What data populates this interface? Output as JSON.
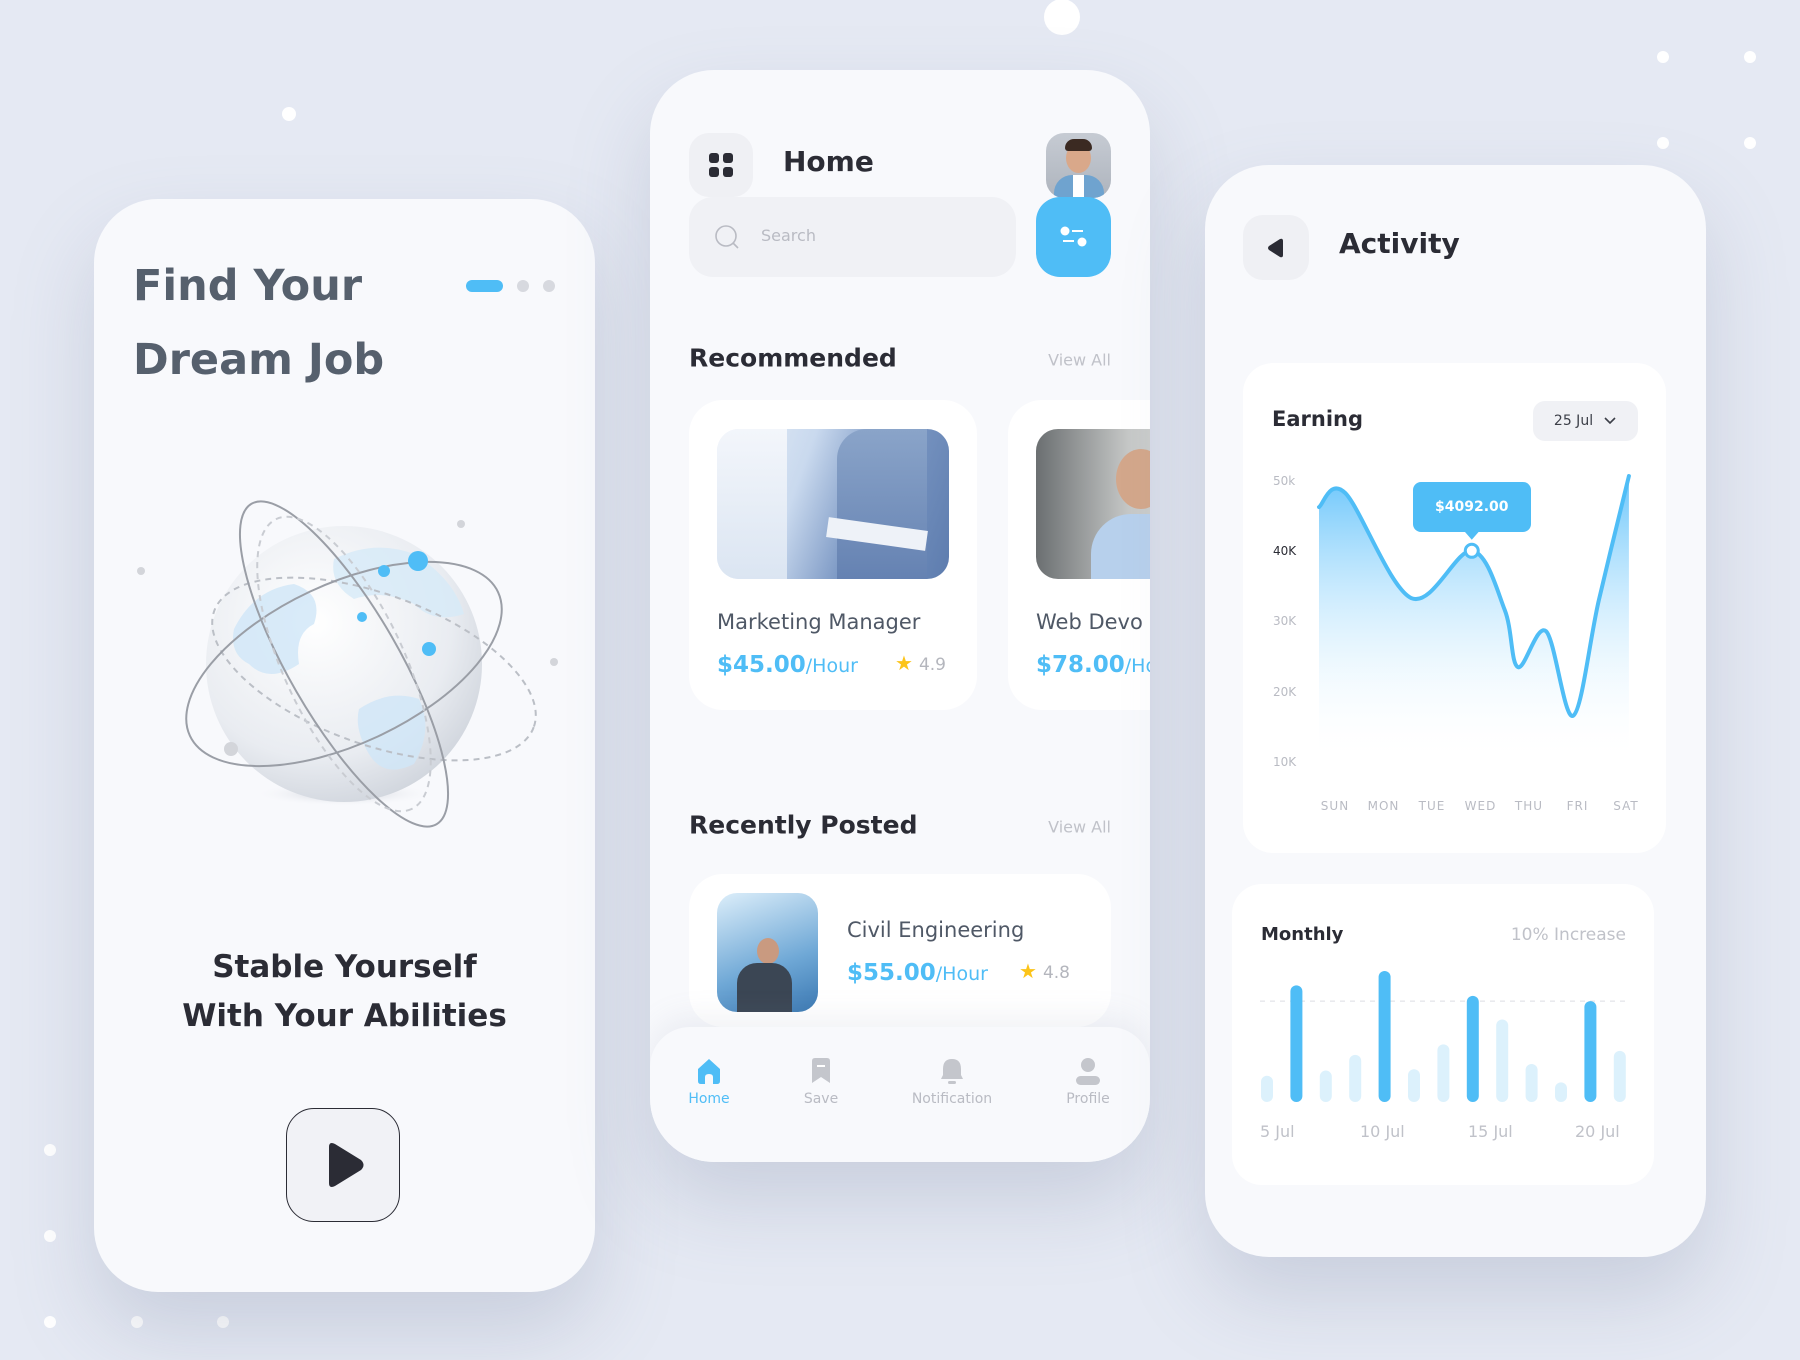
{
  "colors": {
    "accent": "#4fbdf6",
    "background": "#e5e9f3",
    "text_dark": "#2b2c35",
    "muted": "#b9bbc3",
    "star": "#fcc419"
  },
  "onboarding": {
    "title_line1": "Find Your",
    "title_line2": "Dream Job",
    "tagline_line1": "Stable Yourself",
    "tagline_line2": "With Your Abilities",
    "pager": {
      "count": 3,
      "active": 0
    },
    "play_icon": "play-icon",
    "illustration": "globe-with-orbits"
  },
  "home": {
    "menu_icon": "grid-icon",
    "title": "Home",
    "avatar": "user-avatar-photo",
    "search": {
      "placeholder": "Search",
      "icon": "search-icon"
    },
    "filter_icon": "filter-sliders-icon",
    "recommended": {
      "heading": "Recommended",
      "view_all": "View All",
      "jobs": [
        {
          "title": "Marketing Manager",
          "rate": "$45.00",
          "unit": "/Hour",
          "rating": "4.9"
        },
        {
          "title": "Web Devo",
          "rate": "$78.00",
          "unit": "/Hou"
        }
      ]
    },
    "recent": {
      "heading": "Recently Posted",
      "view_all": "View All",
      "jobs": [
        {
          "title": "Civil Engineering",
          "rate": "$55.00",
          "unit": "/Hour",
          "rating": "4.8"
        }
      ]
    },
    "nav": [
      {
        "label": "Home",
        "icon": "home-icon",
        "active": true
      },
      {
        "label": "Save",
        "icon": "bookmark-icon"
      },
      {
        "label": "Notification",
        "icon": "bell-icon"
      },
      {
        "label": "Profile",
        "icon": "user-icon"
      }
    ]
  },
  "activity": {
    "back_icon": "back-arrow-icon",
    "title": "Activity"
  },
  "chart_data": [
    {
      "type": "area",
      "title": "Earning",
      "date_filter": "25 Jul",
      "categories": [
        "SUN",
        "MON",
        "TUE",
        "WED",
        "THU",
        "FRI",
        "SAT"
      ],
      "y_ticks": [
        "50k",
        "40K",
        "30K",
        "20K",
        "10K"
      ],
      "ylim": [
        10,
        50
      ],
      "points": [
        [
          -0.33,
          46.3
        ],
        [
          0.21,
          48.3
        ],
        [
          1.57,
          33.4
        ],
        [
          2.82,
          40.1
        ],
        [
          3.5,
          31.7
        ],
        [
          3.77,
          23.6
        ],
        [
          4.35,
          28.7
        ],
        [
          4.91,
          16.7
        ],
        [
          5.44,
          33.1
        ],
        [
          6.06,
          50.7
        ]
      ],
      "tooltip": {
        "label": "$4092.00",
        "x": 2.82,
        "y": 40.1
      }
    },
    {
      "type": "bar",
      "title": "Monthly",
      "subtitle": "10% Increase",
      "tick_labels": [
        "5 Jul",
        "10 Jul",
        "15 Jul",
        "20 Jul"
      ],
      "values": [
        20,
        89,
        24,
        36,
        100,
        25,
        44,
        81,
        63,
        29,
        15,
        77,
        39
      ],
      "highlighted": [
        1,
        4,
        7,
        11
      ],
      "reference_line": 77
    }
  ]
}
